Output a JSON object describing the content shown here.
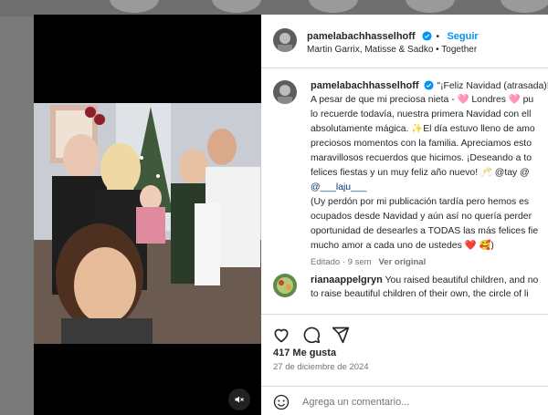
{
  "post": {
    "author": "pamelabachhasselhoff",
    "follow_label": "Seguir",
    "header_subtitle": "Martin Garrix, Matisse & Sadko • Together",
    "caption_lines": [
      "\"¡Feliz Navidad (atrasada)!",
      "A pesar de que mi preciosa nieta - 🩷 Londres 🩷 pu",
      "lo recuerde todavía, nuestra primera Navidad con ell",
      "absolutamente mágica. ✨El día estuvo lleno de amo",
      "preciosos momentos con la familia. Apreciamos esto",
      "maravillosos recuerdos que hicimos. ¡Deseando a to",
      "felices fiestas y un muy feliz año nuevo! 🥂 @tay @",
      "@___laju___",
      "(Uy perdón por mi publicación tardía pero hemos es",
      "ocupados desde Navidad y aún así no quería perder",
      "oportunidad de desearles a TODAS las más felices fie",
      "mucho amor a cada uno de ustedes ❤️ 🥰)"
    ],
    "edited_label": "Editado · 9 sem",
    "see_translation": "Ver original",
    "likes": "417 Me gusta",
    "date": "27 de diciembre de 2024",
    "add_comment_placeholder": "Agrega un comentario..."
  },
  "comment": {
    "author": "rianaappelgryn",
    "line1": "You raised beautiful children, and no",
    "line2": "to raise beautiful children of their own, the circle of li"
  },
  "colors": {
    "link": "#0095f6",
    "verified": "#0095f6",
    "text": "#262626",
    "muted": "#737373"
  },
  "icons": [
    "verified-badge-icon",
    "heart-icon",
    "comment-icon",
    "share-icon",
    "emoji-icon",
    "mute-icon"
  ]
}
